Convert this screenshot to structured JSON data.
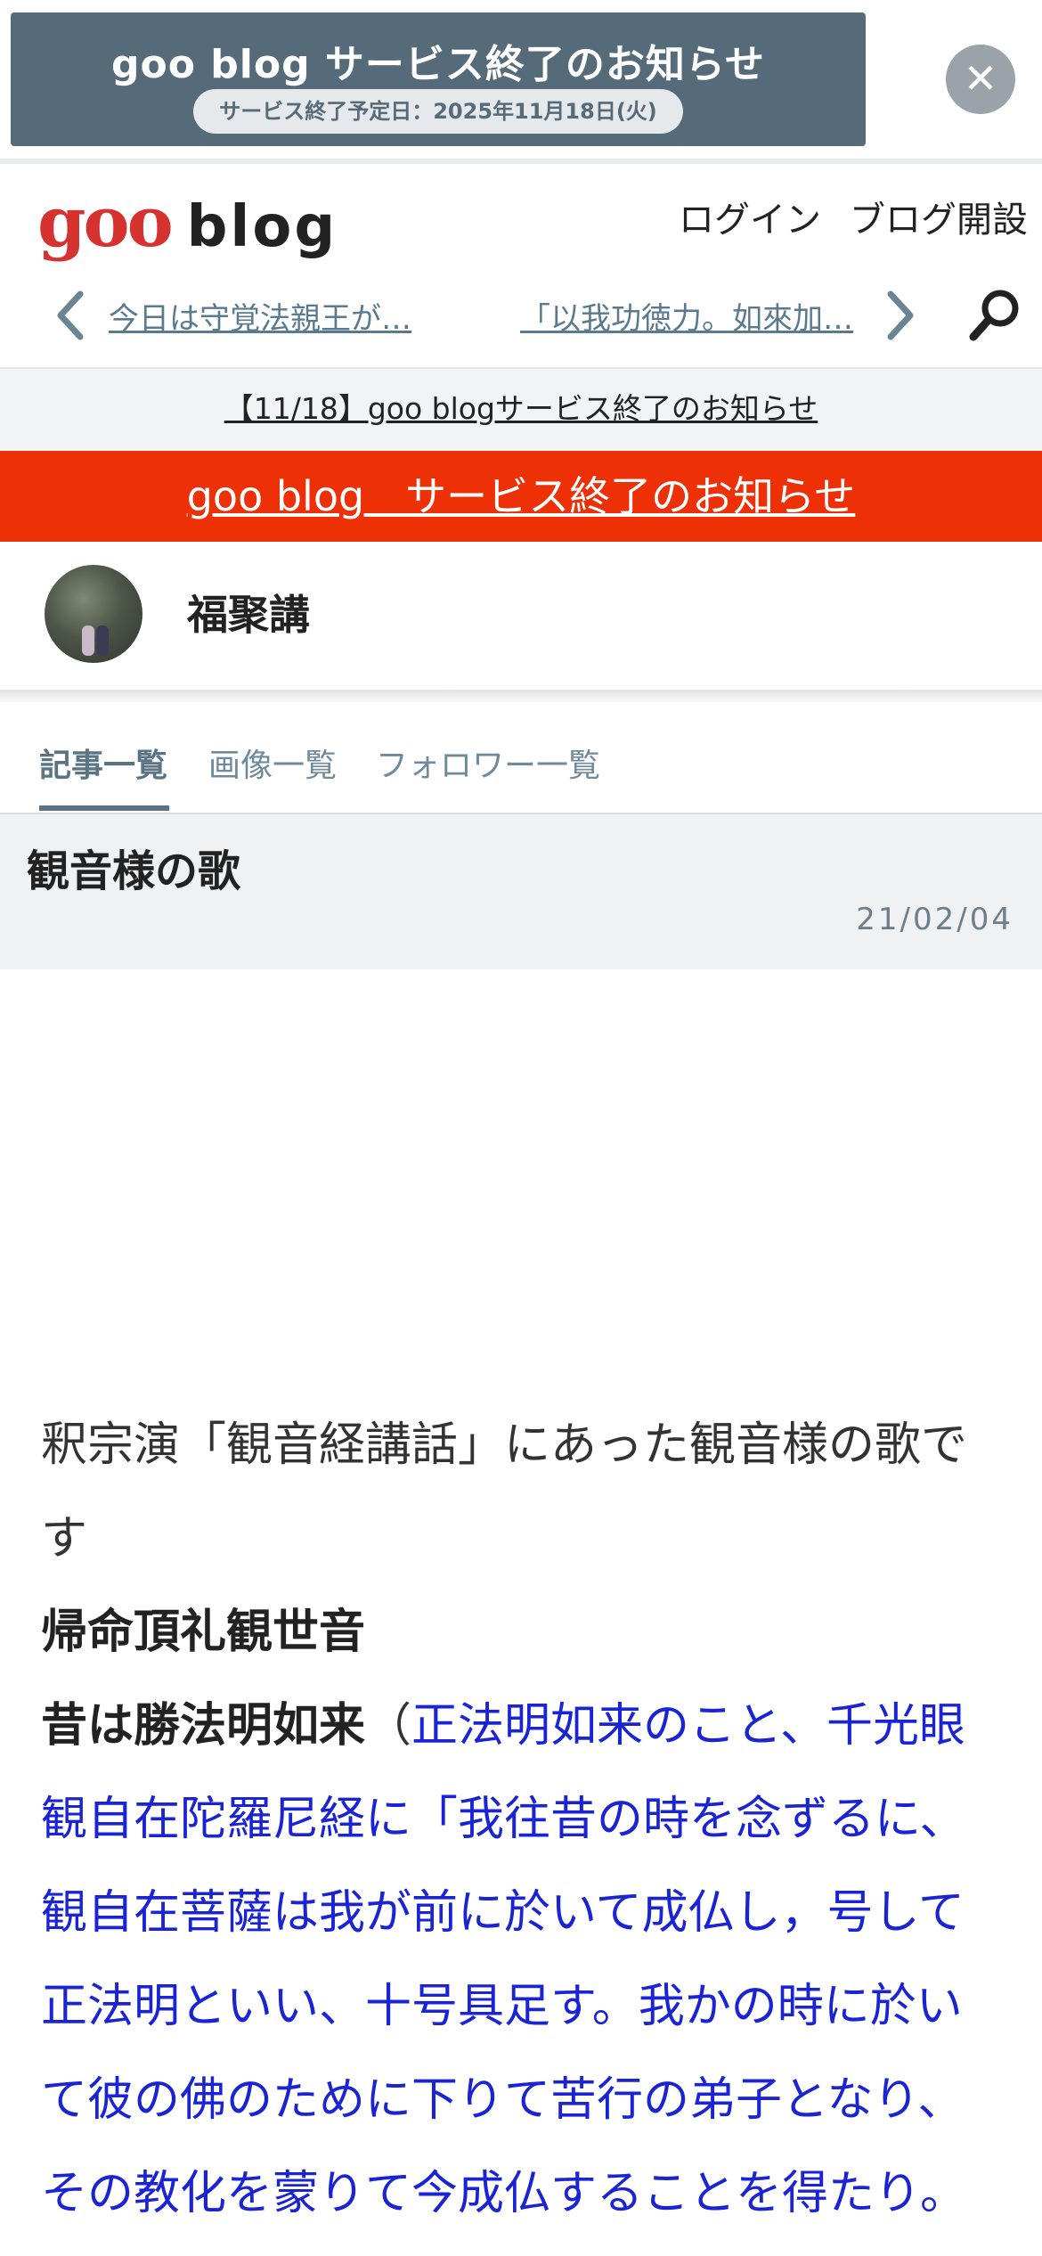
{
  "promo": {
    "title": "goo blog サービス終了のお知らせ",
    "subtitle": "サービス終了予定日：2025年11月18日(火)",
    "close_icon": "close-icon"
  },
  "header": {
    "logo_goo": "goo",
    "logo_blog": "blog",
    "login": "ログイン",
    "open_blog": "ブログ開設"
  },
  "nav": {
    "prev_link": "今日は守覚法親王が…",
    "next_link": "「以我功徳力。如來加…",
    "prev_icon": "chevron-left-icon",
    "next_icon": "chevron-right-icon",
    "search_icon": "search-icon"
  },
  "notice": "【11/18】goo blogサービス終了のお知らせ",
  "red_banner": "goo blog　サービス終了のお知らせ",
  "profile": {
    "blog_name": "福聚講"
  },
  "tabs": [
    {
      "label": "記事一覧",
      "active": true
    },
    {
      "label": "画像一覧",
      "active": false
    },
    {
      "label": "フォロワー一覧",
      "active": false
    }
  ],
  "article": {
    "title": "観音様の歌",
    "date": "21/02/04",
    "lines": [
      {
        "segments": [
          {
            "text": "釈宗演「観音経講話」にあった観音様の歌で",
            "style": "normal"
          }
        ]
      },
      {
        "segments": [
          {
            "text": "す",
            "style": "normal"
          }
        ]
      },
      {
        "segments": [
          {
            "text": "帰命頂礼観世音",
            "style": "bold"
          }
        ]
      },
      {
        "segments": [
          {
            "text": "昔は勝法明如来",
            "style": "bold"
          },
          {
            "text": "（",
            "style": "normal"
          },
          {
            "text": "正法明如来のこと、千光眼",
            "style": "blue"
          }
        ]
      },
      {
        "segments": [
          {
            "text": "観自在陀羅尼経に「我往昔の時を念ずるに、",
            "style": "blue"
          }
        ]
      },
      {
        "segments": [
          {
            "text": "観自在菩薩は我が前に於いて成仏し，号して",
            "style": "blue"
          }
        ]
      },
      {
        "segments": [
          {
            "text": "正法明といい、十号具足す。我かの時に於い",
            "style": "blue"
          }
        ]
      },
      {
        "segments": [
          {
            "text": "て彼の佛のために下りて苦行の弟子となり、",
            "style": "blue"
          }
        ]
      },
      {
        "segments": [
          {
            "text": "その教化を蒙りて今成仏することを得たり。",
            "style": "blue"
          }
        ]
      }
    ]
  },
  "colors": {
    "promo_bg": "#566b79",
    "red_banner": "#ee3007",
    "link_blue": "#1a24d4",
    "logo_red": "#d6322f"
  }
}
